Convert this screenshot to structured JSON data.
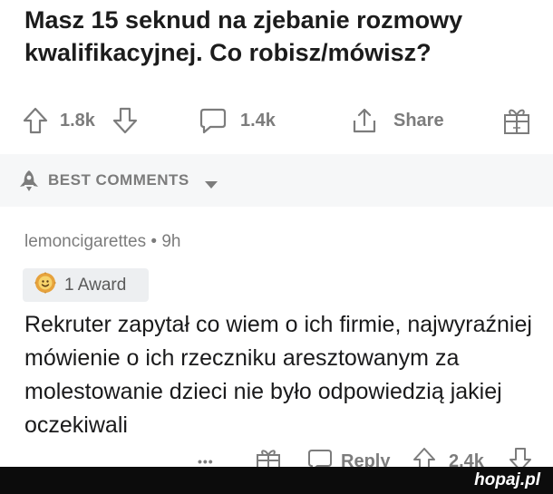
{
  "post": {
    "title": "Masz 15 seknud na zjebanie rozmowy kwalifikacyjnej. Co robisz/mówisz?"
  },
  "post_actions": {
    "upvote_count": "1.8k",
    "comment_count": "1.4k",
    "share_label": "Share",
    "icons": [
      "upvote-icon",
      "downvote-icon",
      "comment-icon",
      "share-icon",
      "award-gift-icon"
    ]
  },
  "sort": {
    "label": "BEST COMMENTS"
  },
  "comment": {
    "author": "lemoncigarettes",
    "separator": "•",
    "time": "9h",
    "award_label": "1 Award",
    "body": "Rekruter zapytał co wiem o ich firmie, najwyraźniej mówienie o ich rzeczniku aresztowanym za molestowanie dzieci nie było odpowiedzią jakiej oczekiwali",
    "actions": {
      "more_label": "•••",
      "reply_label": "Reply",
      "vote_count": "2.4k"
    }
  },
  "footer": {
    "logo": "hopaj.pl"
  },
  "colors": {
    "text": "#1a1a1b",
    "muted": "#7c7c7c",
    "band_bg": "#f6f7f8",
    "award_bg": "#edeff1",
    "footer_bg": "#0c0c0c"
  }
}
